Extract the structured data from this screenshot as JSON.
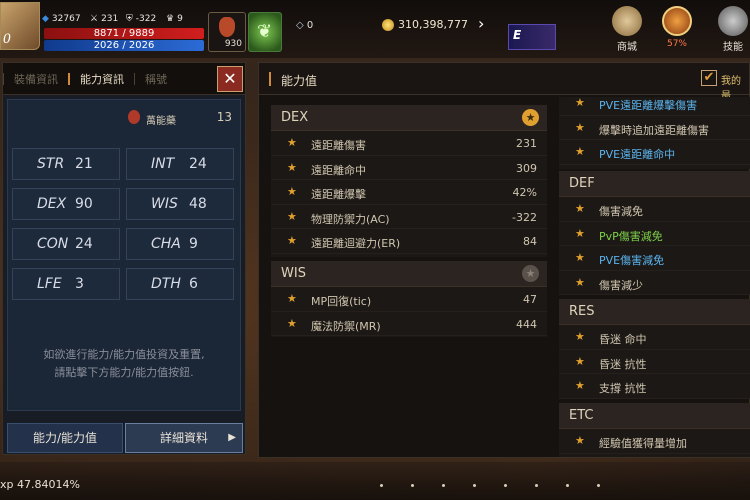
{
  "hud": {
    "level": "0",
    "stat_a": "32767",
    "stat_b": "231",
    "stat_c": "-322",
    "stat_d": "9",
    "hp": "8871 / 9889",
    "mp": "2026 / 2026",
    "potion_count": "930",
    "diamonds": "0",
    "gold": "310,398,777",
    "skill_letter": "E",
    "shop_label": "商城",
    "buff_pct": "57%",
    "skill_label": "技能"
  },
  "left_panel": {
    "tabs": [
      "裝備資訊",
      "能力資訊",
      "稱號"
    ],
    "close": "✕",
    "potion_name": "萬能藥",
    "potion_value": "13",
    "stats": [
      {
        "name": "STR",
        "value": "21"
      },
      {
        "name": "INT",
        "value": "24"
      },
      {
        "name": "DEX",
        "value": "90"
      },
      {
        "name": "WIS",
        "value": "48"
      },
      {
        "name": "CON",
        "value": "24"
      },
      {
        "name": "CHA",
        "value": "9"
      },
      {
        "name": "LFE",
        "value": "3"
      },
      {
        "name": "DTH",
        "value": "6"
      }
    ],
    "hint_line1": "如欲進行能力/能力值投資及重置,",
    "hint_line2": "請點擊下方能力/能力值按鈕.",
    "btn_ability": "能力/能力值",
    "btn_detail": "詳細資料"
  },
  "right_panel": {
    "title": "能力值",
    "check_label": "我的最",
    "dex": {
      "name": "DEX",
      "rows": [
        {
          "label": "遠距離傷害",
          "value": "231"
        },
        {
          "label": "遠距離命中",
          "value": "309"
        },
        {
          "label": "遠距離爆擊",
          "value": "42%"
        },
        {
          "label": "物理防禦力(AC)",
          "value": "-322"
        },
        {
          "label": "遠距離迴避力(ER)",
          "value": "84"
        }
      ]
    },
    "wis": {
      "name": "WIS",
      "rows": [
        {
          "label": "MP回復(tic)",
          "value": "47"
        },
        {
          "label": "魔法防禦(MR)",
          "value": "444"
        }
      ]
    },
    "col2_top": [
      {
        "label": "PVE遠距離爆擊傷害",
        "color": "blue"
      },
      {
        "label": "爆擊時追加遠距離傷害",
        "color": "normal"
      },
      {
        "label": "PVE遠距離命中",
        "color": "blue"
      }
    ],
    "def": {
      "name": "DEF",
      "rows": [
        {
          "label": "傷害減免",
          "color": "normal"
        },
        {
          "label": "PvP傷害減免",
          "color": "green"
        },
        {
          "label": "PVE傷害減免",
          "color": "blue"
        },
        {
          "label": "傷害減少",
          "color": "normal"
        }
      ]
    },
    "res": {
      "name": "RES",
      "rows": [
        {
          "label": "昏迷 命中"
        },
        {
          "label": "昏迷 抗性"
        },
        {
          "label": "支撐 抗性"
        }
      ]
    },
    "etc": {
      "name": "ETC",
      "rows": [
        {
          "label": "經驗值獲得量增加"
        }
      ]
    }
  },
  "bottom": {
    "exp": "xp  47.84014%"
  }
}
